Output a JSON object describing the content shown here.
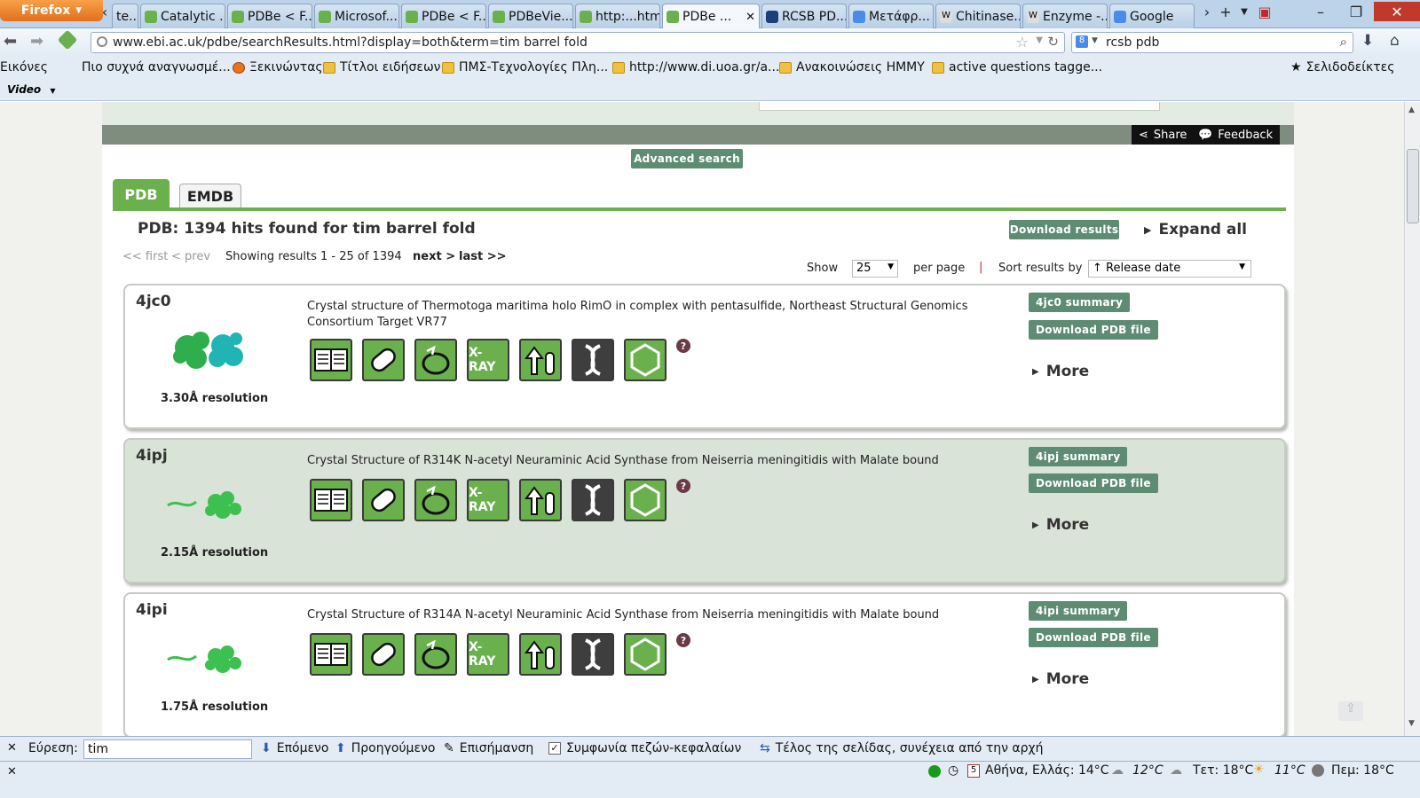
{
  "browser": {
    "menu_button": "Firefox",
    "tabs": [
      {
        "label": "te...",
        "color": "#5a7dd1"
      },
      {
        "label": "Catalytic ...",
        "color": "#6ab04c"
      },
      {
        "label": "PDBe < F...",
        "color": "#6ab04c"
      },
      {
        "label": "Microsof...",
        "color": "#6ab04c"
      },
      {
        "label": "PDBe < F...",
        "color": "#6ab04c"
      },
      {
        "label": "PDBeVie...",
        "color": "#6ab04c"
      },
      {
        "label": "http:...html",
        "color": "#6ab04c"
      },
      {
        "label": "PDBe ...",
        "color": "#6ab04c",
        "active": true
      },
      {
        "label": "RCSB PD...",
        "color": "#1c3f7a"
      },
      {
        "label": "Μετάφρ...",
        "color": "#4a8be8"
      },
      {
        "label": "Chitinase...",
        "color": "#dddddd"
      },
      {
        "label": "Enzyme -...",
        "color": "#dddddd"
      },
      {
        "label": "Google",
        "color": "#4a8be8"
      }
    ],
    "url": "www.ebi.ac.uk/pdbe/searchResults.html?display=both&term=tim barrel fold",
    "search_value": "rcsb pdb",
    "bookmarks": [
      "Εικόνες",
      "Πιο συχνά αναγνωσμέ...",
      "Ξεκινώντας",
      "Τίτλοι ειδήσεων",
      "ΠΜΣ-Τεχνολογίες Πλη...",
      "http://www.di.uoa.gr/a...",
      "Ανακοινώσεις ΗΜΜΥ",
      "active questions tagge..."
    ],
    "bookmarks_menu": "Σελιδοδείκτες",
    "video_label": "Video"
  },
  "page": {
    "share": "Share",
    "feedback": "Feedback",
    "advanced_search": "Advanced search",
    "tabs": [
      "PDB",
      "EMDB"
    ],
    "hits_heading": "PDB: 1394 hits found for tim barrel fold",
    "download_results": "Download results",
    "expand_all": "Expand all",
    "pager": {
      "first": "<< first",
      "prev": "< prev",
      "showing": "Showing results 1 - 25 of 1394",
      "next": "next >",
      "last": "last >>"
    },
    "show_label": "Show",
    "per_page_value": "25",
    "per_page_label": "per page",
    "separator": "|",
    "sort_label": "Sort results by",
    "sort_value": "↑ Release date",
    "icon_labels": [
      "X-RAY"
    ],
    "help_mark": "?",
    "download_pdb": "Download PDB file",
    "more": "More",
    "results": [
      {
        "id": "4jc0",
        "title": "Crystal structure of Thermotoga maritima holo RimO in complex with pentasulfide, Northeast Structural Genomics Consortium Target VR77",
        "resolution": "3.30Å resolution",
        "summary": "4jc0 summary"
      },
      {
        "id": "4ipj",
        "title": "Crystal Structure of R314K N-acetyl Neuraminic Acid Synthase from Neiserria meningitidis with Malate bound",
        "resolution": "2.15Å resolution",
        "summary": "4ipj summary"
      },
      {
        "id": "4ipi",
        "title": "Crystal Structure of R314A N-acetyl Neuraminic Acid Synthase from Neiserria meningitidis with Malate bound",
        "resolution": "1.75Å resolution",
        "summary": "4ipi summary"
      }
    ]
  },
  "findbar": {
    "label": "Εύρεση:",
    "value": "tim",
    "next": "Επόμενο",
    "prev": "Προηγούμενο",
    "highlight": "Επισήμανση",
    "match_case": "Συμφωνία πεζών-κεφαλαίων",
    "wrapped": "Τέλος της σελίδας, συνέχεια από την αρχή"
  },
  "statusbar": {
    "calendar_day": "5",
    "weather_now": "Αθήνα, Ελλάς: 14°C",
    "temp1": "12°C",
    "day2": "Τετ: 18°C",
    "temp2": "11°C",
    "day3": "Πεμ: 18°C"
  },
  "colors": {
    "accent_green": "#6ab04c",
    "button_green": "#5d8c72",
    "card_alt_bg": "#d9e3d7",
    "firefox_orange": "#e3701c"
  }
}
